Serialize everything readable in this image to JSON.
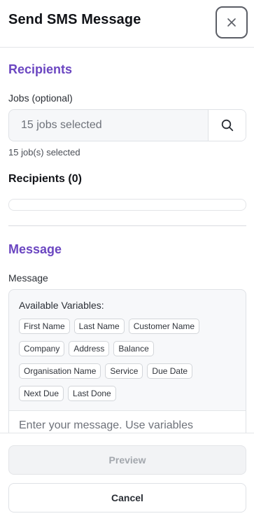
{
  "header": {
    "title": "Send SMS Message",
    "close_icon": "close-icon"
  },
  "recipients_section": {
    "title": "Recipients",
    "jobs_label": "Jobs (optional)",
    "jobs_value": "15 jobs selected",
    "search_icon": "search-icon",
    "helper": "15 job(s) selected",
    "recipients_heading": "Recipients (0)"
  },
  "message_section": {
    "title": "Message",
    "message_label": "Message",
    "variables_title": "Available Variables:",
    "variables": [
      "First Name",
      "Last Name",
      "Customer Name",
      "Company",
      "Address",
      "Balance",
      "Organisation Name",
      "Service",
      "Due Date",
      "Next Due",
      "Last Done"
    ],
    "placeholder": "Enter your message. Use variables"
  },
  "footer": {
    "preview_label": "Preview",
    "cancel_label": "Cancel"
  },
  "colors": {
    "accent": "#6b46c1",
    "border": "#dfe2e6",
    "muted_text": "#6e727a"
  }
}
